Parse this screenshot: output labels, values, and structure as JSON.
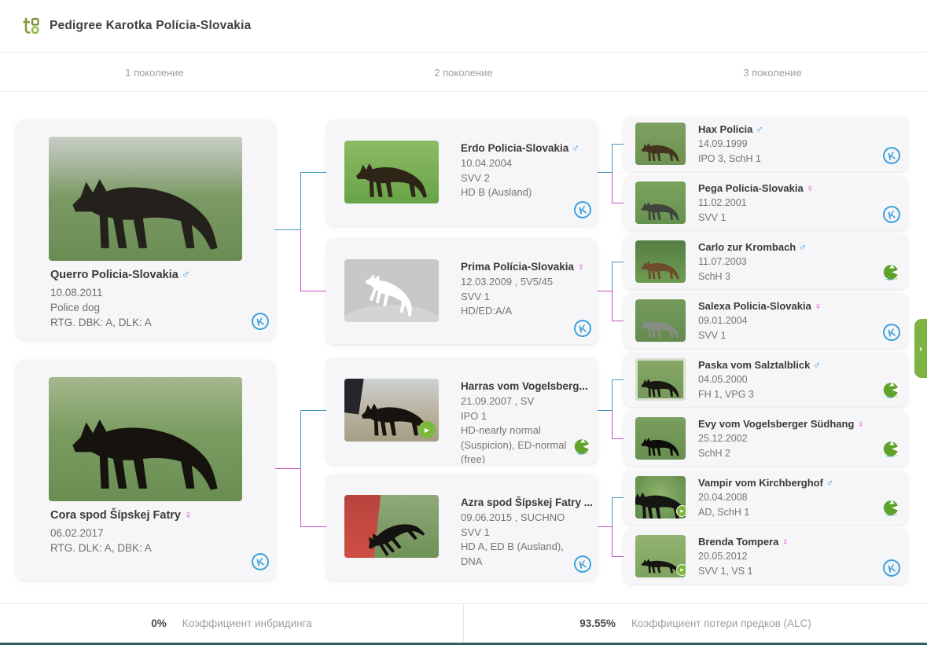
{
  "header": {
    "title": "Pedigree Karotka Polícia-Slovakia"
  },
  "tabs": [
    {
      "label": "1 поколение"
    },
    {
      "label": "2 поколение"
    },
    {
      "label": "3 поколение"
    }
  ],
  "icons": {
    "k_badge": "K",
    "play": "▶",
    "side_chevron": "›"
  },
  "colors": {
    "accent_green": "#7cb342",
    "male_symbol": "#459ae0",
    "female_symbol": "#db4ddb",
    "sire_line": "#4498c0",
    "dam_line": "#c750c9",
    "k_badge_blue": "#3ea2dc",
    "wd_badge_green": "#5fa32b"
  },
  "gen1": [
    {
      "name": "Querro Policia-Slovakia",
      "gender_symbol": "♂",
      "dob": "10.08.2011",
      "note": "Police dog",
      "health": "RTG. DBK: A, DLK: A"
    },
    {
      "name": "Cora spod Šípskej Fatry",
      "gender_symbol": "♀",
      "dob": "06.02.2017",
      "health": "RTG. DLK: A, DBK: A"
    }
  ],
  "gen2": [
    {
      "name": "Erdo Policia-Slovakia",
      "gender_symbol": "♂",
      "dob": "10.04.2004",
      "line2": "SVV 2",
      "line3": "HD B (Ausland)"
    },
    {
      "name": "Prima Polícia-Slovakia",
      "gender_symbol": "♀",
      "dob": "12.03.2009 , 5V5/45",
      "line2": "SVV 1",
      "line3": "HD/ED:A/A"
    },
    {
      "name": "Harras vom Vogelsberg...",
      "dob": "21.09.2007 , SV",
      "line2": "IPO 1",
      "line3": "HD-nearly normal (Suspicion), ED-normal (free)"
    },
    {
      "name": "Azra spod Šípskej Fatry ...",
      "dob": "09.06.2015 , SUCHNO",
      "line2": "SVV 1",
      "line3": "HD A, ED B (Ausland), DNA"
    }
  ],
  "gen3": [
    {
      "name": "Hax Policia",
      "gender_symbol": "♂",
      "dob": "14.09.1999",
      "titles": "IPO 3, SchH 1"
    },
    {
      "name": "Pega Policia-Slovakia",
      "gender_symbol": "♀",
      "dob": "11.02.2001",
      "titles": "SVV 1"
    },
    {
      "name": "Carlo zur Krombach",
      "gender_symbol": "♂",
      "dob": "11.07.2003",
      "titles": "SchH 3"
    },
    {
      "name": "Salexa Policia-Slovakia",
      "gender_symbol": "♀",
      "dob": "09.01.2004",
      "titles": "SVV 1"
    },
    {
      "name": "Paska vom Salztalblick",
      "gender_symbol": "♂",
      "dob": "04.05.2000",
      "titles": "FH 1, VPG 3"
    },
    {
      "name": "Evy vom Vogelsberger Südhang",
      "gender_symbol": "♀",
      "dob": "25.12.2002",
      "titles": "SchH 2"
    },
    {
      "name": "Vampir vom Kirchberghof",
      "gender_symbol": "♂",
      "dob": "20.04.2008",
      "titles": "AD, SchH 1"
    },
    {
      "name": "Brenda Tompera",
      "gender_symbol": "♀",
      "dob": "20.05.2012",
      "titles": "SVV 1, VS 1"
    }
  ],
  "footer": {
    "inbreeding": {
      "value": "0%",
      "label": "Коэффициент инбридинга"
    },
    "alc": {
      "value": "93.55%",
      "label": "Коэффициент потери предков (ALC)"
    }
  }
}
